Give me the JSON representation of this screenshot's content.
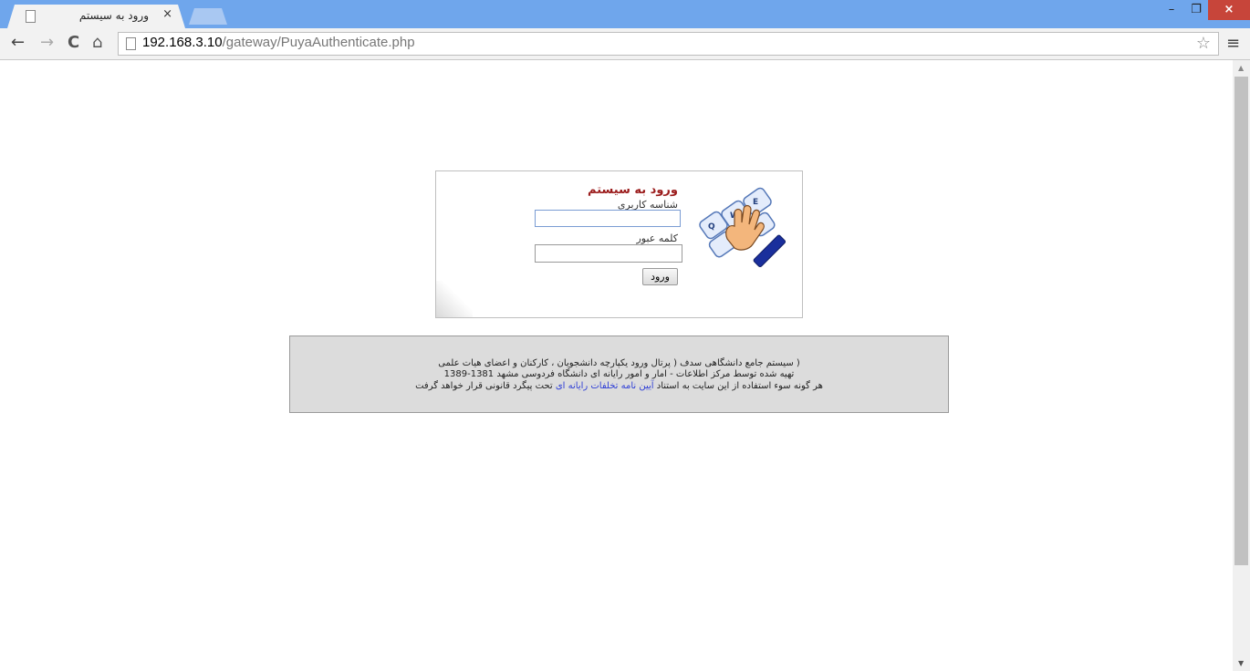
{
  "browser": {
    "tab_title": "ورود به سیستم",
    "tab_close": "×",
    "url_host": "192.168.3.10",
    "url_path": "/gateway/PuyaAuthenticate.php",
    "window_min": "–",
    "window_max": "❐",
    "window_close": "×",
    "nav_back": "←",
    "nav_forward": "→",
    "nav_reload": "C",
    "nav_home": "⌂",
    "star": "☆",
    "menu": "≡"
  },
  "login": {
    "title": "ورود به سیستم",
    "username_label": "شناسه کاربری",
    "password_label": "کلمه عبور",
    "username_value": "",
    "password_value": "",
    "submit_label": "ورود",
    "keyboard_keys": [
      "Q",
      "W",
      "E"
    ]
  },
  "info": {
    "line1": "( سیستم جامع دانشگاهی سدف ( پرتال ورود یکپارچه دانشجویان ، کارکنان و اعضای هیات علمی",
    "line2": "تهیه شده توسط مرکز اطلاعات - امار و امور رایانه ای دانشگاه فردوسی مشهد 1381-1389",
    "line3_before": "هر گونه سوء استفاده از این سایت به استناد ",
    "line3_link": "آیین نامه تخلفات رایانه ای",
    "line3_after": " تحت پیگرد قانونی قرار خواهد گرفت"
  },
  "colors": {
    "titlebar": "#6fa6ec",
    "title_red": "#9b1c1c",
    "link_blue": "#2f3fd6",
    "info_bg": "#dcdcdc",
    "close_btn": "#c7453a"
  }
}
